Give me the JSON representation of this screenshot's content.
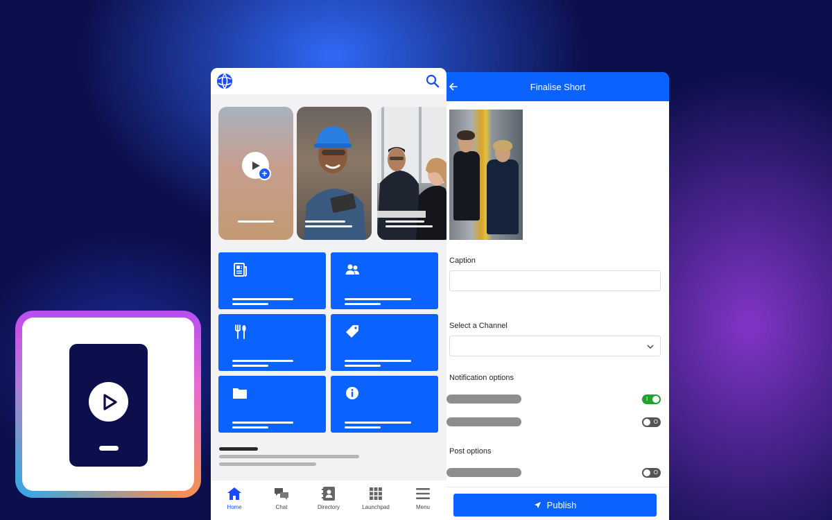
{
  "home": {
    "nav": [
      {
        "label": "Home",
        "icon": "home-icon",
        "active": true
      },
      {
        "label": "Chat",
        "icon": "chat-icon",
        "active": false
      },
      {
        "label": "Directory",
        "icon": "directory-icon",
        "active": false
      },
      {
        "label": "Launchpad",
        "icon": "launchpad-icon",
        "active": false
      },
      {
        "label": "Menu",
        "icon": "menu-icon",
        "active": false
      }
    ],
    "tiles": [
      "newspaper-icon",
      "people-icon",
      "cutlery-icon",
      "tag-icon",
      "folder-icon",
      "info-icon"
    ]
  },
  "finalise": {
    "title": "Finalise Short",
    "caption_label": "Caption",
    "caption_value": "",
    "channel_label": "Select a Channel",
    "channel_value": "",
    "notification_label": "Notification options",
    "post_label": "Post options",
    "toggles": [
      {
        "state": "on",
        "mark": "I"
      },
      {
        "state": "off",
        "mark": "O"
      },
      {
        "state": "off",
        "mark": "O"
      }
    ],
    "publish_label": "Publish"
  },
  "colors": {
    "accent": "#0a63ff",
    "toggle_on": "#23a12e",
    "badge_dark": "#0d0f4d"
  }
}
